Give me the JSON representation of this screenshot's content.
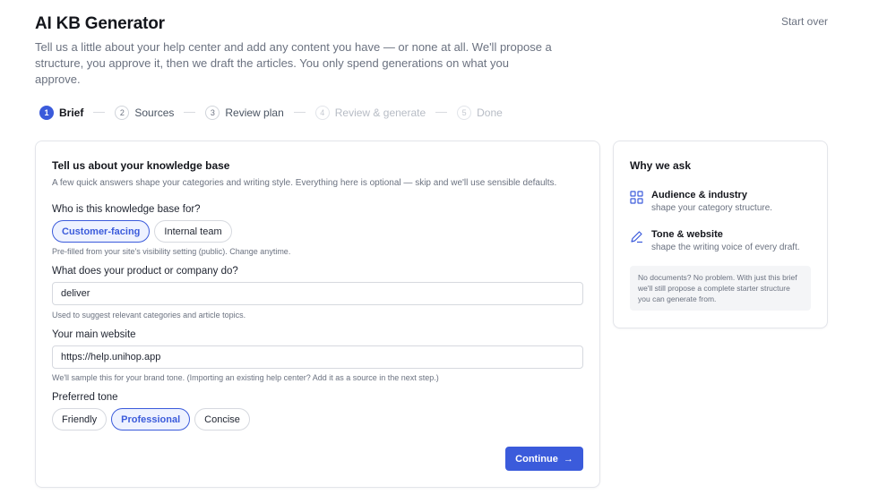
{
  "header": {
    "title": "AI KB Generator",
    "start_over": "Start over",
    "intro": "Tell us a little about your help center and add any content you have — or none at all. We'll propose a structure, you approve it, then we draft the articles. You only spend generations on what you approve."
  },
  "stepper": {
    "steps": [
      {
        "num": "1",
        "label": "Brief",
        "state": "active"
      },
      {
        "num": "2",
        "label": "Sources",
        "state": "upcoming"
      },
      {
        "num": "3",
        "label": "Review plan",
        "state": "upcoming"
      },
      {
        "num": "4",
        "label": "Review & generate",
        "state": "muted"
      },
      {
        "num": "5",
        "label": "Done",
        "state": "muted"
      }
    ]
  },
  "form": {
    "title": "Tell us about your knowledge base",
    "subtitle": "A few quick answers shape your categories and writing style. Everything here is optional — skip and we'll use sensible defaults.",
    "audience": {
      "label": "Who is this knowledge base for?",
      "options": [
        "Customer-facing",
        "Internal team"
      ],
      "selected": "Customer-facing",
      "hint": "Pre-filled from your site's visibility setting (public). Change anytime."
    },
    "product": {
      "label": "What does your product or company do?",
      "value": "deliver",
      "hint": "Used to suggest relevant categories and article topics."
    },
    "website": {
      "label": "Your main website",
      "value": "https://help.unihop.app",
      "hint": "We'll sample this for your brand tone. (Importing an existing help center? Add it as a source in the next step.)"
    },
    "tone": {
      "label": "Preferred tone",
      "options": [
        "Friendly",
        "Professional",
        "Concise"
      ],
      "selected": "Professional"
    },
    "continue_label": "Continue"
  },
  "sidebar": {
    "title": "Why we ask",
    "reasons": [
      {
        "icon": "grid-icon",
        "title": "Audience & industry",
        "desc": "shape your category structure."
      },
      {
        "icon": "pen-icon",
        "title": "Tone & website",
        "desc": "shape the writing voice of every draft."
      }
    ],
    "note": "No documents? No problem. With just this brief we'll still propose a complete starter structure you can generate from."
  },
  "colors": {
    "accent": "#3b5bdb",
    "accent_soft": "#eef2ff",
    "muted_text": "#6b7280"
  }
}
